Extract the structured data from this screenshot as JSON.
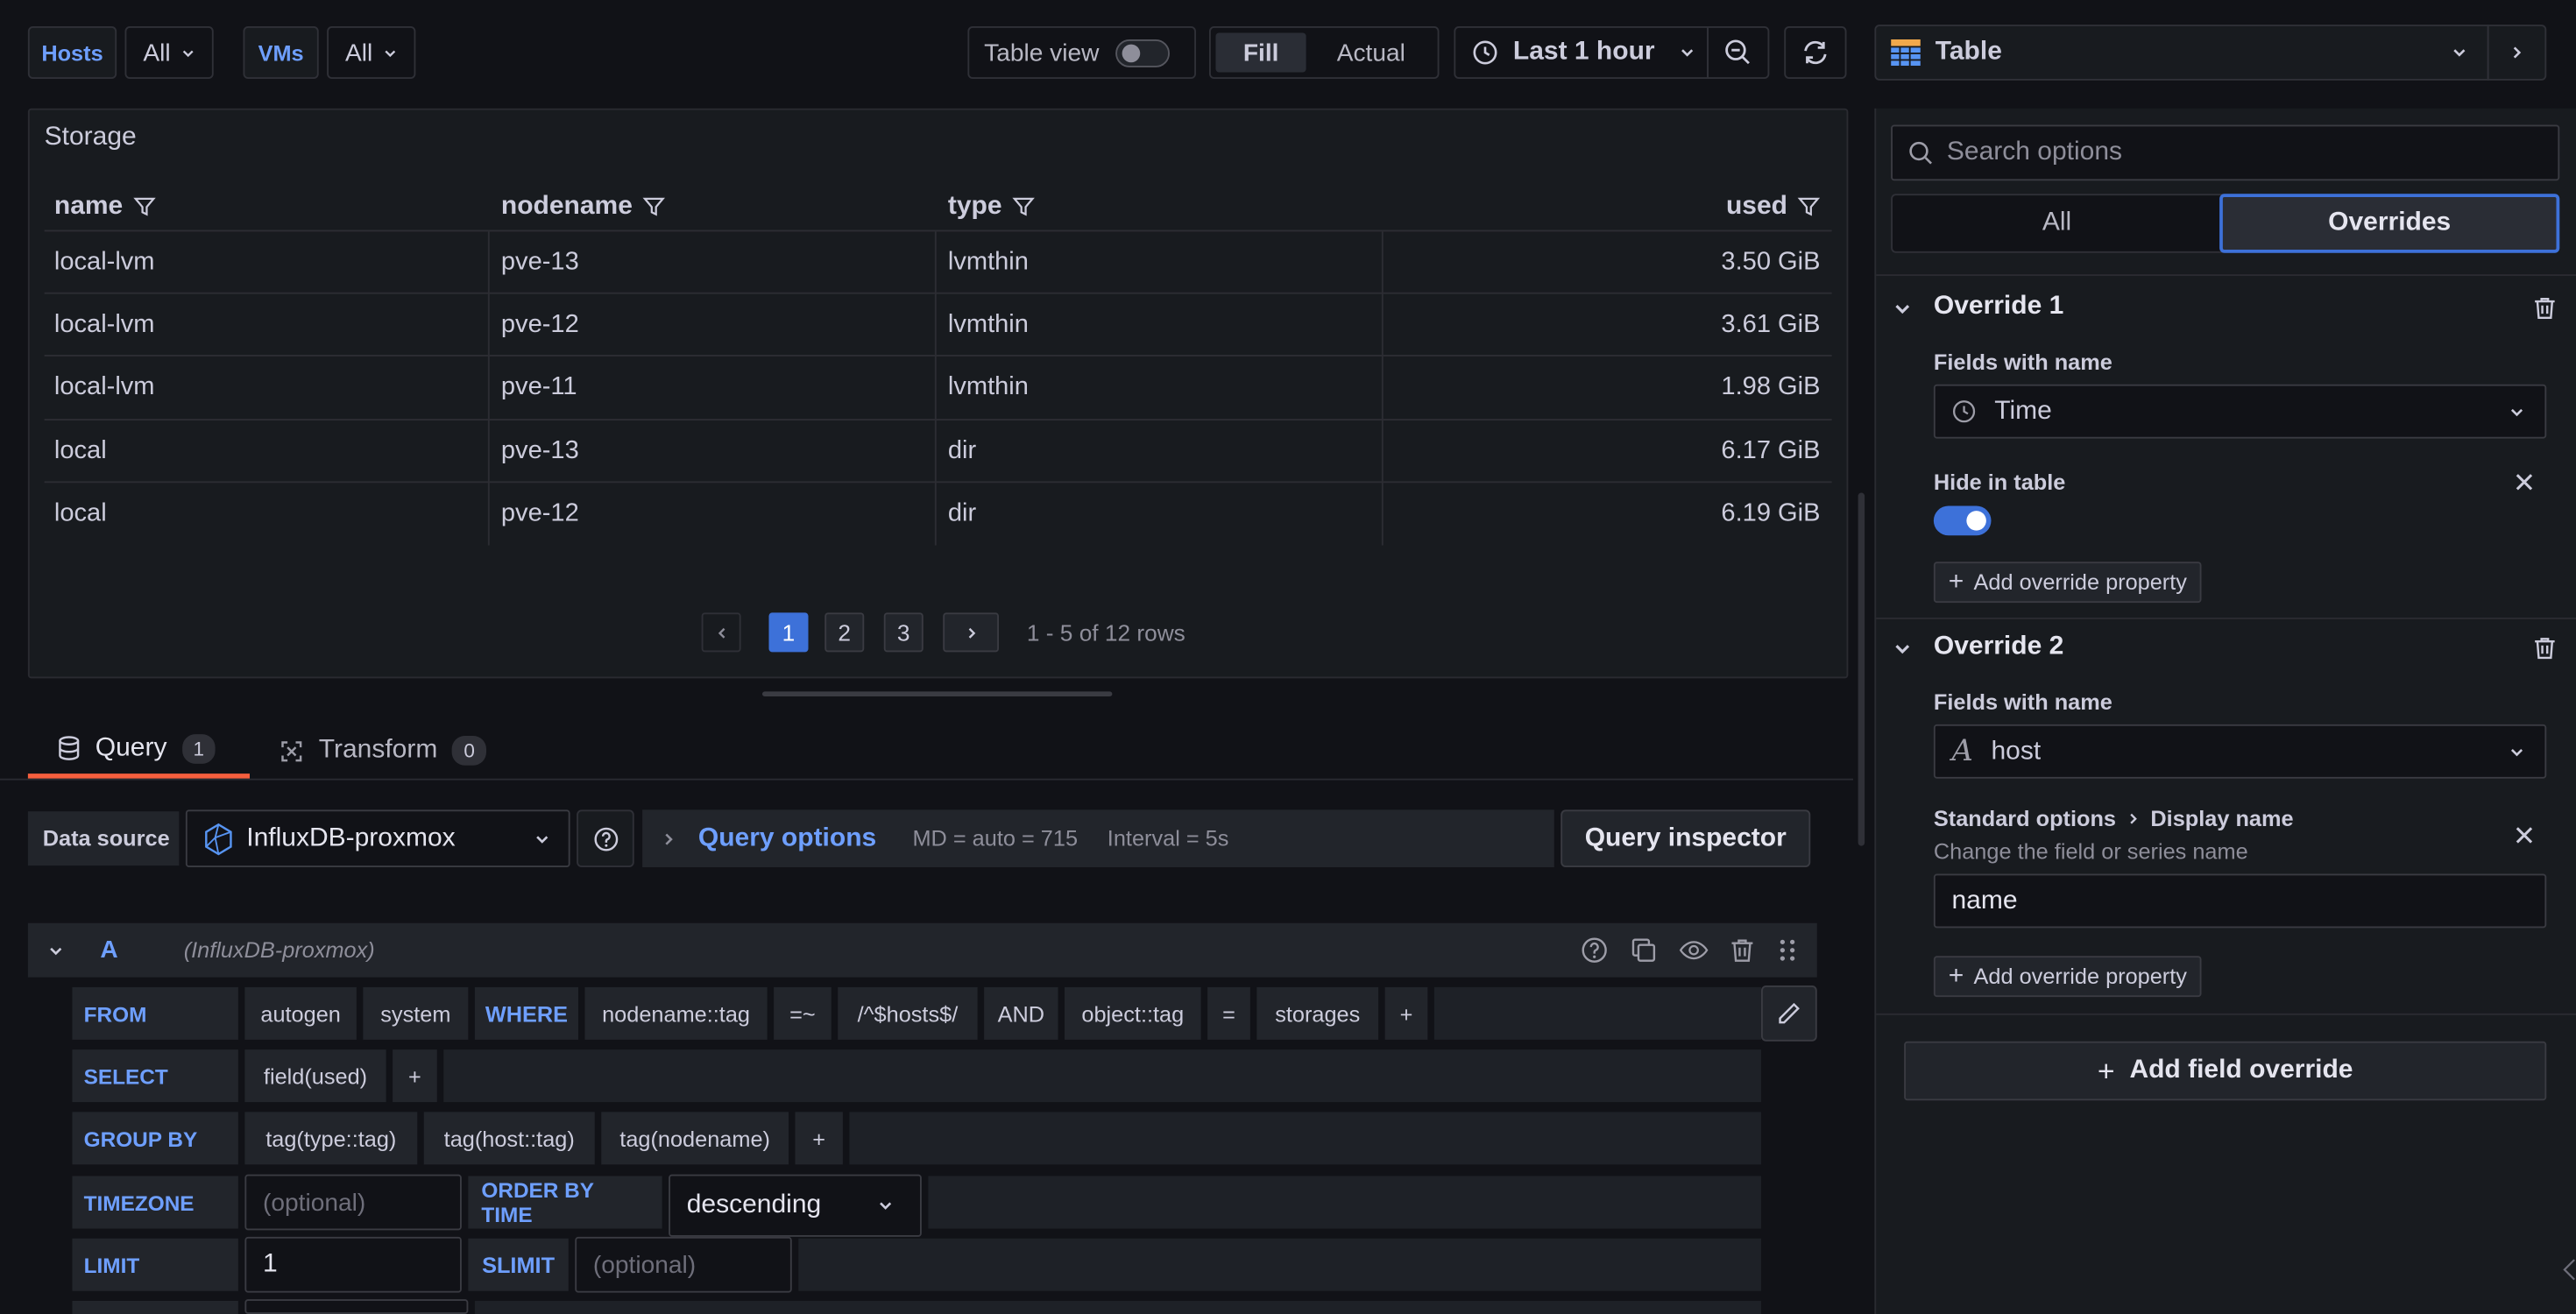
{
  "toolbar": {
    "hosts_label": "Hosts",
    "hosts_value": "All",
    "vms_label": "VMs",
    "vms_value": "All",
    "table_view_label": "Table view",
    "fill_label": "Fill",
    "actual_label": "Actual",
    "time_range": "Last 1 hour",
    "viz_picker": "Table"
  },
  "panel": {
    "title": "Storage",
    "columns": [
      "name",
      "nodename",
      "type",
      "used"
    ],
    "rows": [
      [
        "local-lvm",
        "pve-13",
        "lvmthin",
        "3.50 GiB"
      ],
      [
        "local-lvm",
        "pve-12",
        "lvmthin",
        "3.61 GiB"
      ],
      [
        "local-lvm",
        "pve-11",
        "lvmthin",
        "1.98 GiB"
      ],
      [
        "local",
        "pve-13",
        "dir",
        "6.17 GiB"
      ],
      [
        "local",
        "pve-12",
        "dir",
        "6.19 GiB"
      ]
    ],
    "pagination": {
      "pages": [
        "1",
        "2",
        "3"
      ],
      "current": "1",
      "summary": "1 - 5 of 12 rows"
    }
  },
  "tabs": {
    "query_label": "Query",
    "query_count": "1",
    "transform_label": "Transform",
    "transform_count": "0"
  },
  "datasource": {
    "label": "Data source",
    "value": "InfluxDB-proxmox",
    "query_options": "Query options",
    "md": "MD = auto = 715",
    "interval": "Interval = 5s",
    "inspector": "Query inspector"
  },
  "query": {
    "ref": "A",
    "source": "(InfluxDB-proxmox)",
    "from_label": "FROM",
    "from_chips": [
      "autogen",
      "system"
    ],
    "where_label": "WHERE",
    "where_chips": [
      "nodename::tag",
      "=~",
      "/^$hosts$/",
      "AND",
      "object::tag",
      "=",
      "storages",
      "+"
    ],
    "select_label": "SELECT",
    "select_chips": [
      "field(used)",
      "+"
    ],
    "groupby_label": "GROUP BY",
    "groupby_chips": [
      "tag(type::tag)",
      "tag(host::tag)",
      "tag(nodename)",
      "+"
    ],
    "timezone_label": "TIMEZONE",
    "timezone_placeholder": "(optional)",
    "orderby_label": "ORDER BY TIME",
    "orderby_value": "descending",
    "limit_label": "LIMIT",
    "limit_value": "1",
    "slimit_label": "SLIMIT",
    "slimit_placeholder": "(optional)"
  },
  "options_pane": {
    "search_placeholder": "Search options",
    "tab_all": "All",
    "tab_overrides": "Overrides",
    "override1": {
      "title": "Override 1",
      "matcher_label": "Fields with name",
      "matcher_value": "Time",
      "property_label": "Hide in table",
      "add_property": "Add override property"
    },
    "override2": {
      "title": "Override 2",
      "matcher_label": "Fields with name",
      "matcher_value": "host",
      "property_path": "Standard options",
      "property_name": "Display name",
      "property_desc": "Change the field or series name",
      "property_value": "name",
      "add_property": "Add override property"
    },
    "add_field_override": "Add field override"
  },
  "colors": {
    "background": "#111217",
    "panel": "#181b1f",
    "accent": "#3d71d9",
    "link": "#6e9fff",
    "tab_underline": "#f55f3e"
  }
}
